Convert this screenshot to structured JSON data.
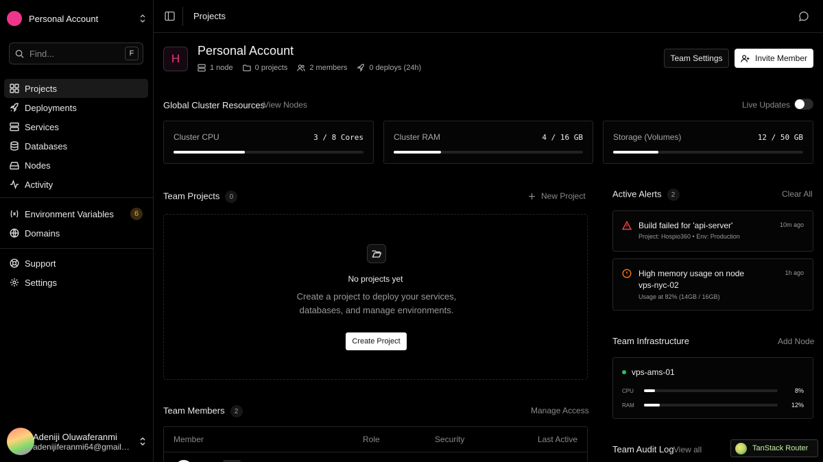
{
  "sidebar": {
    "account_name": "Personal Account",
    "find_placeholder": "Find...",
    "find_shortcut": "F",
    "nav_main": [
      {
        "label": "Projects",
        "icon": "grid-icon"
      },
      {
        "label": "Deployments",
        "icon": "rocket-icon"
      },
      {
        "label": "Services",
        "icon": "server-icon"
      },
      {
        "label": "Databases",
        "icon": "database-icon"
      },
      {
        "label": "Nodes",
        "icon": "hard-drive-icon"
      },
      {
        "label": "Activity",
        "icon": "activity-icon"
      }
    ],
    "nav_config": [
      {
        "label": "Environment Variables",
        "icon": "variable-icon",
        "badge": "6"
      },
      {
        "label": "Domains",
        "icon": "globe-icon"
      }
    ],
    "nav_footer": [
      {
        "label": "Support",
        "icon": "lifebuoy-icon"
      },
      {
        "label": "Settings",
        "icon": "gear-icon"
      }
    ],
    "user": {
      "name": "Adeniji Oluwaferanmi",
      "email": "adenijiferanmi64@gmail.com"
    }
  },
  "topbar": {
    "breadcrumb": "Projects"
  },
  "header": {
    "logo_letter": "H",
    "title": "Personal Account",
    "meta": {
      "nodes": "1 node",
      "projects": "0 projects",
      "members": "2 members",
      "deploys": "0 deploys (24h)"
    },
    "team_settings_label": "Team Settings",
    "invite_label": "Invite Member"
  },
  "cluster": {
    "title": "Global Cluster Resources",
    "view_nodes": "View Nodes",
    "live_updates": "Live Updates",
    "live_updates_on": false,
    "cards": [
      {
        "label": "Cluster CPU",
        "value": "3 / 8 Cores",
        "fraction": 0.375
      },
      {
        "label": "Cluster RAM",
        "value": "4 / 16 GB",
        "fraction": 0.25
      },
      {
        "label": "Storage (Volumes)",
        "value": "12 / 50 GB",
        "fraction": 0.24
      }
    ]
  },
  "projects": {
    "title": "Team Projects",
    "count": "0",
    "new_label": "New Project",
    "empty_title": "No projects yet",
    "empty_text": "Create a project to deploy your services, databases, and manage environments.",
    "create_label": "Create Project"
  },
  "members": {
    "title": "Team Members",
    "count": "2",
    "manage_label": "Manage Access",
    "columns": [
      "Member",
      "Role",
      "Security",
      "Last Active"
    ]
  },
  "alerts": {
    "title": "Active Alerts",
    "count": "2",
    "clear_label": "Clear All",
    "items": [
      {
        "icon": "warning-triangle-icon",
        "color": "#ef4444",
        "title": "Build failed for 'api-server'",
        "subtitle": "Project: Hospio360 • Env: Production",
        "time": "10m ago"
      },
      {
        "icon": "alert-circle-icon",
        "color": "#f97316",
        "title": "High memory usage on node vps-nyc-02",
        "subtitle": "Usage at 82% (14GB / 16GB)",
        "time": "1h ago"
      }
    ]
  },
  "infrastructure": {
    "title": "Team Infrastructure",
    "add_label": "Add Node",
    "node": {
      "name": "vps-ams-01",
      "status_color": "#22c55e",
      "cpu_label": "CPU",
      "cpu_value": "8%",
      "cpu_fraction": 0.08,
      "ram_label": "RAM",
      "ram_value": "12%",
      "ram_fraction": 0.12
    }
  },
  "audit": {
    "title": "Team Audit Log",
    "view_all": "View all"
  },
  "devtools": {
    "label": "TanStack Router"
  }
}
